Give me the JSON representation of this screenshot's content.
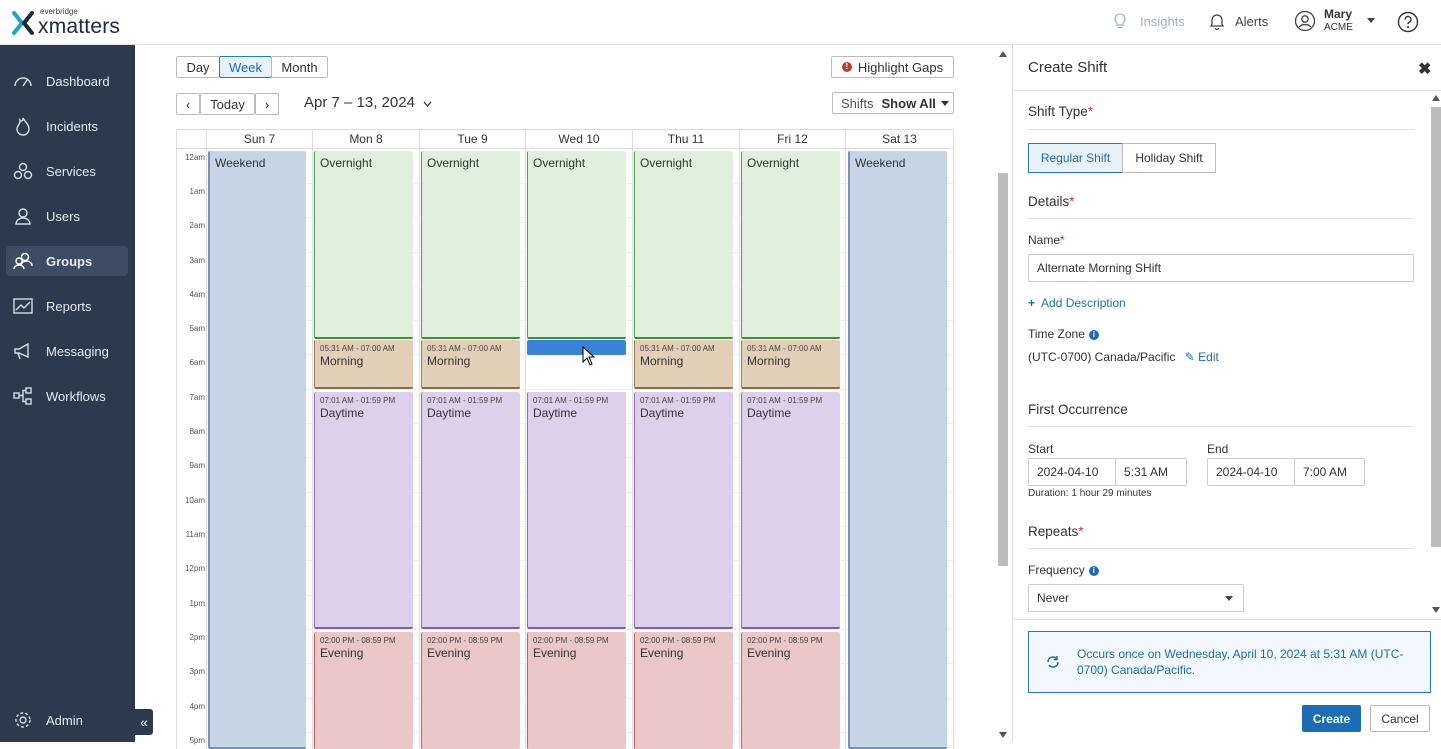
{
  "header": {
    "logo_small": "everbridge",
    "logo_big": "xmatters",
    "insights": "Insights",
    "alerts": "Alerts",
    "user_name": "Mary",
    "user_org": "ACME"
  },
  "sidebar": {
    "items": [
      {
        "label": "Dashboard",
        "icon": "dashboard-icon"
      },
      {
        "label": "Incidents",
        "icon": "flame-icon"
      },
      {
        "label": "Services",
        "icon": "services-icon"
      },
      {
        "label": "Users",
        "icon": "user-icon"
      },
      {
        "label": "Groups",
        "icon": "groups-icon",
        "active": true
      },
      {
        "label": "Reports",
        "icon": "chart-icon"
      },
      {
        "label": "Messaging",
        "icon": "megaphone-icon"
      },
      {
        "label": "Workflows",
        "icon": "workflow-icon"
      }
    ],
    "admin": "Admin"
  },
  "calendar": {
    "views": [
      "Day",
      "Week",
      "Month"
    ],
    "selected_view": "Week",
    "today": "Today",
    "prev": "‹",
    "next": "›",
    "range": "Apr 7 – 13, 2024",
    "highlight_gaps": "Highlight Gaps",
    "shifts_label": "Shifts",
    "shifts_value": "Show All",
    "days": [
      "Sun 7",
      "Mon 8",
      "Tue 9",
      "Wed 10",
      "Thu 11",
      "Fri 12",
      "Sat 13"
    ],
    "hours": [
      "12am",
      "1am",
      "2am",
      "3am",
      "4am",
      "5am",
      "6am",
      "7am",
      "8am",
      "9am",
      "10am",
      "11am",
      "12pm",
      "1pm",
      "2pm",
      "3pm",
      "4pm",
      "5pm"
    ],
    "shift_names": {
      "weekend": "Weekend",
      "overnight": "Overnight",
      "morning": "Morning",
      "daytime": "Daytime",
      "evening": "Evening"
    },
    "shift_times": {
      "morning": "05:31 AM - 07:00 AM",
      "daytime": "07:01 AM - 01:59 PM",
      "evening": "02:00 PM - 08:59 PM"
    }
  },
  "panel": {
    "title": "Create Shift",
    "shift_type_label": "Shift Type",
    "regular_shift": "Regular Shift",
    "holiday_shift": "Holiday Shift",
    "details_label": "Details",
    "name_label": "Name",
    "name_value": "Alternate Morning SHift",
    "add_description": "Add Description",
    "time_zone_label": "Time Zone",
    "time_zone_value": "(UTC-0700) Canada/Pacific",
    "edit": "Edit",
    "first_occurrence": "First Occurrence",
    "start_label": "Start",
    "start_date": "2024-04-10",
    "start_time": "5:31 AM",
    "end_label": "End",
    "end_date": "2024-04-10",
    "end_time": "7:00 AM",
    "duration": "Duration: 1 hour 29 minutes",
    "repeats_label": "Repeats",
    "frequency_label": "Frequency",
    "frequency_value": "Never",
    "occurs_text": "Occurs once on Wednesday, April 10, 2024 at 5:31 AM (UTC-0700) Canada/Pacific.",
    "create": "Create",
    "cancel": "Cancel"
  }
}
